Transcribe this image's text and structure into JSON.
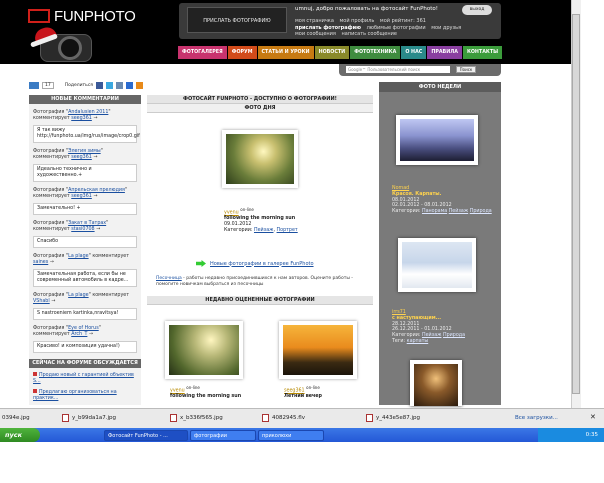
{
  "header": {
    "logo_text": "FUNPHOTO",
    "upload_button": "ПРИСЛАТЬ ФОТОГРАФИЮ",
    "welcome": "umnuj, добро пожаловать на фотосайт FunPhoto!",
    "logout": "выход",
    "user_links": [
      "моя страничка",
      "мой профиль",
      "мой рейтинг: 361",
      "прислать фотографию",
      "любимые фотографии",
      "мои друзья",
      "мои сообщения",
      "написать сообщение"
    ],
    "nav": [
      {
        "label": "ФОТОГАЛЕРЕЯ",
        "color": "#c8336e"
      },
      {
        "label": "ФОРУМ",
        "color": "#d24b1a"
      },
      {
        "label": "СТАТЬИ И УРОКИ",
        "color": "#c77a12"
      },
      {
        "label": "НОВОСТИ",
        "color": "#8a8a2a"
      },
      {
        "label": "ФОТОТЕХНИКА",
        "color": "#3f8c3f"
      },
      {
        "label": "О НАС",
        "color": "#2a8a8a"
      },
      {
        "label": "ПРАВИЛА",
        "color": "#8a3fa0"
      },
      {
        "label": "КОНТАКТЫ",
        "color": "#3b9c3b"
      }
    ],
    "search_placeholder": "Google™ Пользовательский поиск",
    "search_button": "Поиск"
  },
  "social": {
    "count": "17",
    "share_label": "Поделиться"
  },
  "left": {
    "head": "НОВЫЕ КОММЕНТАРИИ",
    "comments": [
      {
        "meta_pre": "Фотография \"",
        "photo": "Andalusien 2011",
        "meta_mid": "\" комментирует ",
        "user": "seeg361",
        "text": "Я так вижу http://funphoto.ua/img/rus/image/crop0.gif"
      },
      {
        "meta_pre": "Фотография \"",
        "photo": "Элегия зимы",
        "meta_mid": "\" комментирует ",
        "user": "seeg361",
        "text": "Идеально технично и художественно.+"
      },
      {
        "meta_pre": "Фотография \"",
        "photo": "Апрельская прелюдия",
        "meta_mid": "\" комментирует ",
        "user": "seeg361",
        "text": "Замечательно! +"
      },
      {
        "meta_pre": "Фотография \"",
        "photo": "Закат в Татрах",
        "meta_mid": "\" комментирует ",
        "user": "stasi0708",
        "text": "Спасибо"
      },
      {
        "meta_pre": "Фотография \"",
        "photo": "La plage",
        "meta_mid": "\" комментирует ",
        "user": "saines",
        "text": "Замечательная работа, если бы не современный автомобиль в кадре..."
      },
      {
        "meta_pre": "Фотография \"",
        "photo": "La plage",
        "meta_mid": "\" комментирует ",
        "user": "VShabl",
        "text": "S nastroeniem kartinka,nravitsya!"
      },
      {
        "meta_pre": "Фотография \"",
        "photo": "Eye of Horus",
        "meta_mid": "\" комментирует ",
        "user": "Arch_T",
        "text": "Красиво! и композиция удачна!)"
      }
    ],
    "forum_head": "СЕЙЧАС НА ФОРУМЕ ОБСУЖДАЕТСЯ",
    "forum_items": [
      "Продаю новый с гарантией объектив S...",
      "Предлагаю организоваться на практик..."
    ]
  },
  "middle": {
    "main_head": "ФОТОСАЙТ FUNPHOTO - ДОСТУПНО О ФОТОГРАФИИ!",
    "day_head": "ФОТО ДНЯ",
    "day_user": "yvenu",
    "day_online": "on-line",
    "day_title": "following the morning sun",
    "day_date": "09.01.2012",
    "day_cats_label": "Категории:",
    "day_cats": [
      "Пейзаж",
      "Портрет"
    ],
    "gallery_link": "Новые фотографии в галерее FunPhoto",
    "sandbox_link": "Песочница",
    "sandbox_text": " - работы недавно присоединившихся к нам авторов. Оцените работы - помогите новичкам выбраться из песочницы",
    "recent_head": "НЕДАВНО ОЦЕНЕННЫЕ ФОТОГРАФИИ",
    "recent": [
      {
        "user": "yvenu",
        "online": "on-line",
        "title": "following the morning sun"
      },
      {
        "user": "seeg361",
        "online": "on-line",
        "title": "Летний вечер"
      }
    ]
  },
  "right": {
    "head": "ФОТО НЕДЕЛИ",
    "items": [
      {
        "user": "Nomad",
        "title": "Красоя. Карпаты.",
        "date": "08.01.2012",
        "range": "02.01.2012 - 08.01.2012",
        "cats": [
          "Панорама",
          "Пейзаж",
          "Природа"
        ]
      },
      {
        "user": "irrs71",
        "title": "с наступающим...",
        "date": "28.12.2011",
        "range": "26.12.2011 - 01.01.2012",
        "cats": [
          "Пейзаж",
          "Природа"
        ],
        "tags": [
          "карпаты"
        ]
      }
    ],
    "cats_label": "Категории:",
    "tags_label": "Теги:"
  },
  "downloads": {
    "items": [
      "0394e.jpg",
      "y_b99da1a7.jpg",
      "x_b336f565.jpg",
      "4082945.flv",
      "y_443e5e87.jpg"
    ],
    "show_all": "Все загрузки..."
  },
  "taskbar": {
    "start": "пуск",
    "windows": [
      "Фотосайт FunPhoto - ...",
      "фотографии",
      "приколюхи"
    ],
    "clock": "0:35"
  }
}
